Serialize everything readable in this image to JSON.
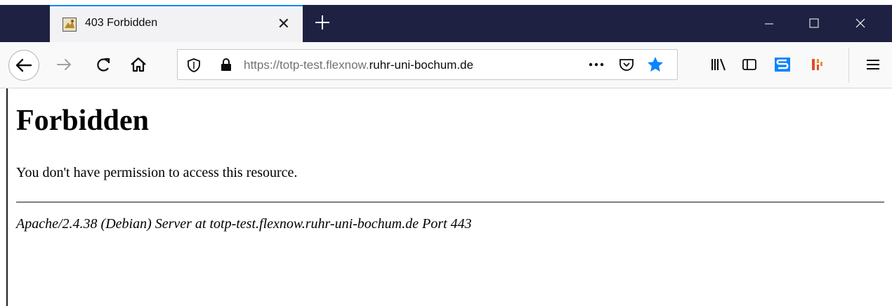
{
  "tab": {
    "title": "403 Forbidden"
  },
  "url": {
    "prefix": "https://totp-test.flexnow.",
    "domain": "ruhr-uni-bochum.de"
  },
  "page": {
    "heading": "Forbidden",
    "message": "You don't have permission to access this resource.",
    "address": "Apache/2.4.38 (Debian) Server at totp-test.flexnow.ruhr-uni-bochum.de Port 443"
  },
  "colors": {
    "tabbar": "#1f2143",
    "accent": "#0a84ff",
    "star": "#0a84ff",
    "sync": "#0a84ff",
    "ext": "#e34c26"
  }
}
